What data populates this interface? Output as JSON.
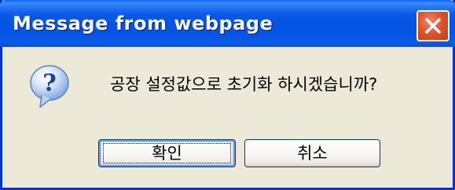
{
  "window": {
    "title": "Message from webpage"
  },
  "titlebar_icons": {
    "close": "close-icon"
  },
  "dialog": {
    "icon": "question-icon",
    "message": "공장 설정값으로 초기화 하시겠습니까?"
  },
  "buttons": {
    "ok_label": "확인",
    "cancel_label": "취소"
  },
  "colors": {
    "titlebar": "#0553e4",
    "window_border": "#0831d9",
    "client_background": "#ece9d8",
    "close_button": "#e0542f",
    "button_border": "#003c74"
  }
}
